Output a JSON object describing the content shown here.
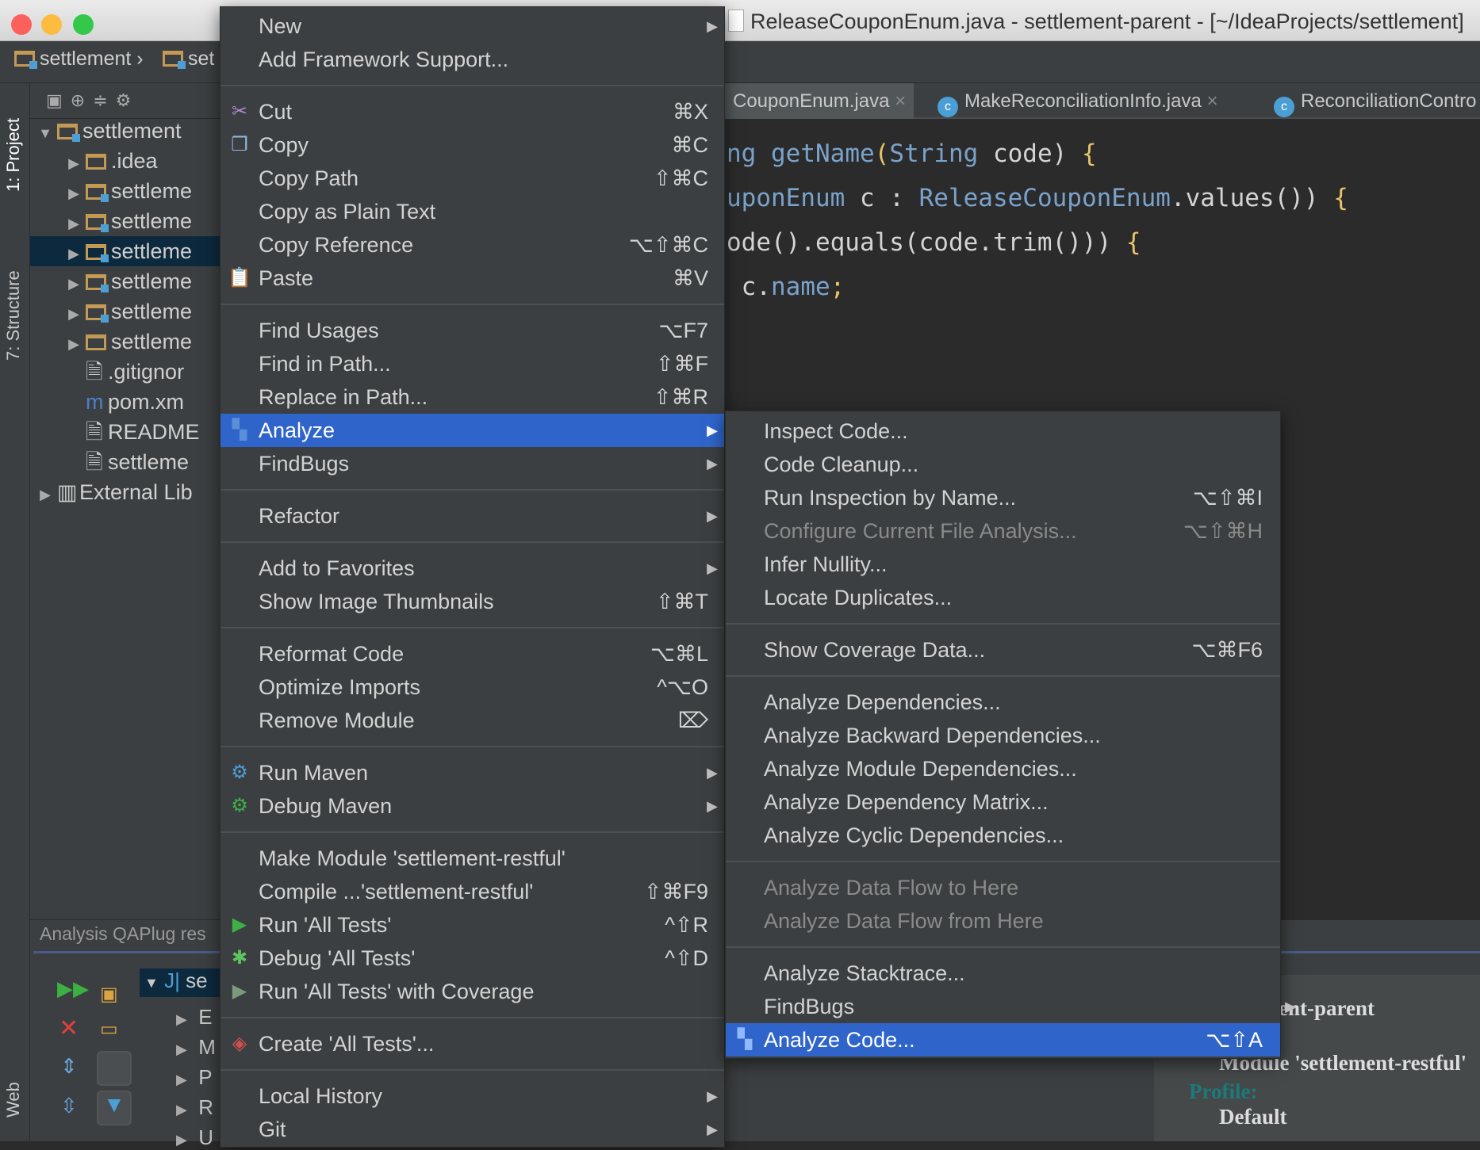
{
  "window": {
    "title": "ReleaseCouponEnum.java - settlement-parent - [~/IdeaProjects/settlement]",
    "lights": [
      "#fc605c",
      "#fdbc40",
      "#34c84a"
    ]
  },
  "breadcrumb": [
    "settlement",
    "set"
  ],
  "sidebar": {
    "tabs": [
      "1: Project",
      "7: Structure",
      "Web"
    ]
  },
  "project_tree": [
    {
      "label": "settlement",
      "arrow": "▼",
      "depth": 0,
      "icon": "module-folder"
    },
    {
      "label": ".idea",
      "arrow": "▶",
      "depth": 1,
      "icon": "folder"
    },
    {
      "label": "settleme",
      "arrow": "▶",
      "depth": 1,
      "icon": "module-folder"
    },
    {
      "label": "settleme",
      "arrow": "▶",
      "depth": 1,
      "icon": "module-folder"
    },
    {
      "label": "settleme",
      "arrow": "▶",
      "depth": 1,
      "icon": "module-folder",
      "selected": true
    },
    {
      "label": "settleme",
      "arrow": "▶",
      "depth": 1,
      "icon": "module-folder"
    },
    {
      "label": "settleme",
      "arrow": "▶",
      "depth": 1,
      "icon": "module-folder"
    },
    {
      "label": "settleme",
      "arrow": "▶",
      "depth": 1,
      "icon": "folder"
    },
    {
      "label": ".gitignor",
      "arrow": "",
      "depth": 1,
      "icon": "file"
    },
    {
      "label": "pom.xm",
      "arrow": "",
      "depth": 1,
      "icon": "maven"
    },
    {
      "label": "README",
      "arrow": "",
      "depth": 1,
      "icon": "markdown"
    },
    {
      "label": "settleme",
      "arrow": "",
      "depth": 1,
      "icon": "file"
    },
    {
      "label": "External Lib",
      "arrow": "▶",
      "depth": 0,
      "icon": "library"
    }
  ],
  "editor": {
    "tabs": [
      {
        "label": "CouponEnum.java"
      },
      {
        "label": "MakeReconciliationInfo.java"
      },
      {
        "label": "ReconciliationContro"
      }
    ],
    "close_glyph": "×"
  },
  "bottom": {
    "tabs": "Analysis   QAPlug res",
    "tree_root": "se",
    "tree_items": [
      "E",
      "M",
      "P",
      "R",
      "U"
    ],
    "results": {
      "project": "ent-parent",
      "scope": "Module 'settlement-restful'",
      "profile_label": "Profile:",
      "profile": "Default"
    }
  },
  "colors": {
    "menu_bg": "#3c3f41",
    "highlight": "#2f65ca",
    "editor_bg": "#2b2b2b"
  },
  "context_menu": [
    {
      "label": "New",
      "arrow": true
    },
    {
      "label": "Add Framework Support..."
    },
    {
      "sep": true
    },
    {
      "label": "Cut",
      "shortcut": "⌘X",
      "icon": "scissors-icon",
      "glyph": "✂",
      "color": "#b58ad6"
    },
    {
      "label": "Copy",
      "shortcut": "⌘C",
      "icon": "copy-icon",
      "glyph": "❐",
      "color": "#8fb8de"
    },
    {
      "label": "Copy Path",
      "shortcut": "⇧⌘C"
    },
    {
      "label": "Copy as Plain Text"
    },
    {
      "label": "Copy Reference",
      "shortcut": "⌥⇧⌘C"
    },
    {
      "label": "Paste",
      "shortcut": "⌘V",
      "icon": "paste-icon",
      "glyph": "📋",
      "color": "#d9a441"
    },
    {
      "sep": true
    },
    {
      "label": "Find Usages",
      "shortcut": "⌥F7"
    },
    {
      "label": "Find in Path...",
      "shortcut": "⇧⌘F"
    },
    {
      "label": "Replace in Path...",
      "shortcut": "⇧⌘R"
    },
    {
      "label": "Analyze",
      "arrow": true,
      "selected": true,
      "icon": "analyze-icon",
      "glyph": "▚",
      "color": "#5b8fd9"
    },
    {
      "label": "FindBugs",
      "arrow": true
    },
    {
      "sep": true
    },
    {
      "label": "Refactor",
      "arrow": true
    },
    {
      "sep": true
    },
    {
      "label": "Add to Favorites",
      "arrow": true
    },
    {
      "label": "Show Image Thumbnails",
      "shortcut": "⇧⌘T"
    },
    {
      "sep": true
    },
    {
      "label": "Reformat Code",
      "shortcut": "⌥⌘L"
    },
    {
      "label": "Optimize Imports",
      "shortcut": "^⌥O"
    },
    {
      "label": "Remove Module",
      "shortcut": "⌦"
    },
    {
      "sep": true
    },
    {
      "label": "Run Maven",
      "arrow": true,
      "icon": "gear-icon",
      "glyph": "⚙",
      "color": "#4b9fd5"
    },
    {
      "label": "Debug Maven",
      "arrow": true,
      "icon": "gear-debug-icon",
      "glyph": "⚙",
      "color": "#3cb043"
    },
    {
      "sep": true
    },
    {
      "label": "Make Module 'settlement-restful'"
    },
    {
      "label": "Compile ...'settlement-restful'",
      "shortcut": "⇧⌘F9"
    },
    {
      "label": "Run 'All Tests'",
      "shortcut": "^⇧R",
      "icon": "run-icon",
      "glyph": "▶",
      "color": "#3cb043"
    },
    {
      "label": "Debug 'All Tests'",
      "shortcut": "^⇧D",
      "icon": "bug-icon",
      "glyph": "✱",
      "color": "#5ec45e"
    },
    {
      "label": "Run 'All Tests' with Coverage",
      "icon": "coverage-icon",
      "glyph": "▶",
      "color": "#7a9a7a"
    },
    {
      "sep": true
    },
    {
      "label": "Create 'All Tests'...",
      "icon": "create-test-icon",
      "glyph": "◈",
      "color": "#d05050"
    },
    {
      "sep": true
    },
    {
      "label": "Local History",
      "arrow": true
    },
    {
      "label": "Git",
      "arrow": true
    }
  ],
  "analyze_submenu": [
    {
      "label": "Inspect Code..."
    },
    {
      "label": "Code Cleanup..."
    },
    {
      "label": "Run Inspection by Name...",
      "shortcut": "⌥⇧⌘I"
    },
    {
      "label": "Configure Current File Analysis...",
      "shortcut": "⌥⇧⌘H",
      "disabled": true
    },
    {
      "label": "Infer Nullity..."
    },
    {
      "label": "Locate Duplicates..."
    },
    {
      "sep": true
    },
    {
      "label": "Show Coverage Data...",
      "shortcut": "⌥⌘F6"
    },
    {
      "sep": true
    },
    {
      "label": "Analyze Dependencies..."
    },
    {
      "label": "Analyze Backward Dependencies..."
    },
    {
      "label": "Analyze Module Dependencies..."
    },
    {
      "label": "Analyze Dependency Matrix..."
    },
    {
      "label": "Analyze Cyclic Dependencies..."
    },
    {
      "sep": true
    },
    {
      "label": "Analyze Data Flow to Here",
      "disabled": true
    },
    {
      "label": "Analyze Data Flow from Here",
      "disabled": true
    },
    {
      "sep": true
    },
    {
      "label": "Analyze Stacktrace..."
    },
    {
      "label": "FindBugs",
      "arrow": true
    },
    {
      "label": "Analyze Code...",
      "shortcut": "⌥⇧A",
      "selected": true,
      "icon": "analyze-icon",
      "glyph": "▚",
      "color": "#8fb8ff"
    }
  ],
  "code": {
    "lines": [
      [
        {
          "t": "ng ",
          "c": "kw"
        },
        {
          "t": "getName",
          "c": "kw"
        },
        {
          "t": "(",
          "c": "br"
        },
        {
          "t": "String",
          "c": "kw"
        },
        {
          "t": " code",
          "c": ""
        },
        {
          "t": ") ",
          "c": ""
        },
        {
          "t": "{",
          "c": "br"
        }
      ],
      [
        {
          "t": "uponEnum",
          "c": "kw"
        },
        {
          "t": " c : ",
          "c": ""
        },
        {
          "t": "ReleaseCouponEnum",
          "c": "kw"
        },
        {
          "t": ".values()) ",
          "c": ""
        },
        {
          "t": "{",
          "c": "br"
        }
      ],
      [
        {
          "t": "ode().equals(code.trim())) ",
          "c": ""
        },
        {
          "t": "{",
          "c": "br"
        }
      ],
      [
        {
          "t": " c.",
          "c": ""
        },
        {
          "t": "name",
          "c": "kw"
        },
        {
          "t": ";",
          "c": "br"
        }
      ]
    ]
  }
}
